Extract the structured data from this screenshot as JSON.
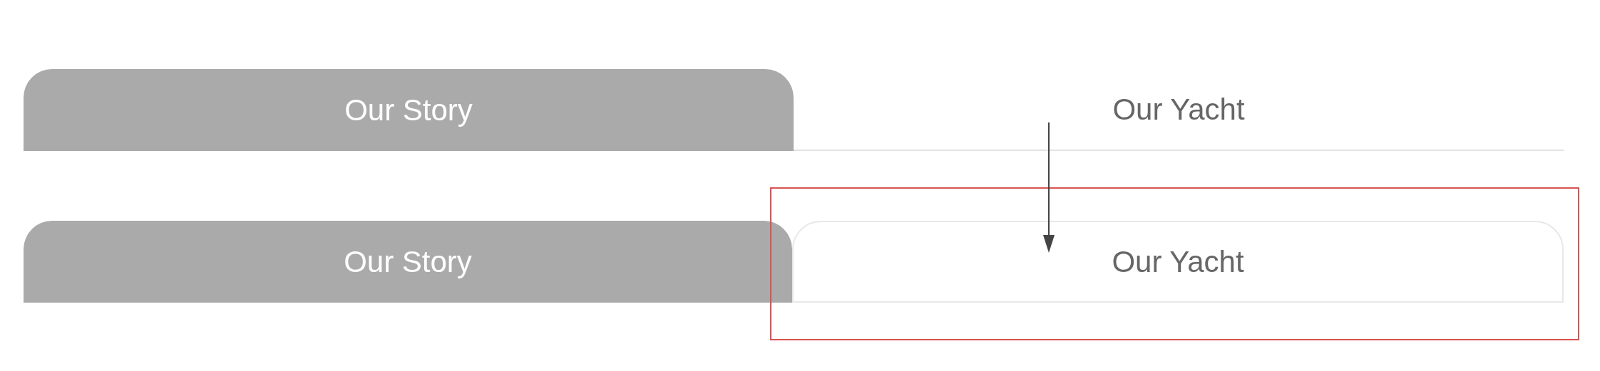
{
  "tab_rows": [
    {
      "kind": "underline",
      "tabs": [
        {
          "label": "Our Story",
          "selected": true
        },
        {
          "label": "Our Yacht",
          "selected": false
        }
      ]
    },
    {
      "kind": "outlined",
      "tabs": [
        {
          "label": "Our Story",
          "selected": true
        },
        {
          "label": "Our Yacht",
          "selected": false
        }
      ]
    }
  ]
}
